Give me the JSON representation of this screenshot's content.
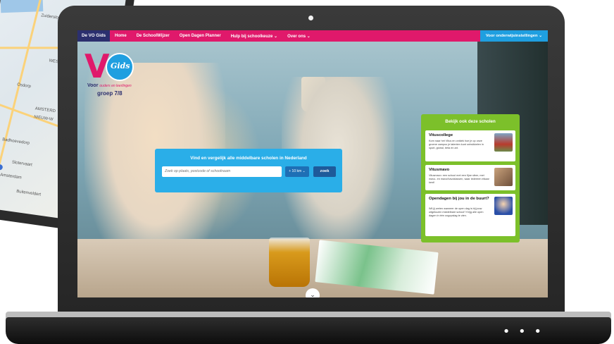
{
  "map": {
    "labels": [
      "Zuidersloot",
      "WESTPO",
      "AMSTERD",
      "NIEUW-W",
      "Badhoevedorp",
      "Osdorp",
      "Slotervaart",
      "Amsterdam",
      "Buitenveldert"
    ]
  },
  "nav": {
    "brand": "De VO Gids",
    "items": [
      "Home",
      "De SchoolWijzer",
      "Open Dagen Planner",
      "Hulp bij schoolkeuze ⌄",
      "Over ons ⌄"
    ],
    "right": "Voor onderwijsinstellingen ⌄"
  },
  "logo": {
    "letter": "V",
    "circle_text": "Gids",
    "line1_a": "Voor",
    "line1_b": "ouders en leerlingen",
    "line2": "groep 7/8"
  },
  "search": {
    "title": "Vind en vergelijk alle middelbare scholen in Nederland",
    "placeholder": "Zoek op plaats, postcode of schoolnaam",
    "radius": "+ 10 km ⌄",
    "button": "zoek"
  },
  "panel": {
    "title": "Bekijk ook deze scholen",
    "cards": [
      {
        "title": "Vituscollege",
        "desc": "Kom naar het Vitus en ontdek hoe je op onze groene campus je talenten kunt ontwikkelen in sport, global, bèta en art."
      },
      {
        "title": "Vitusmavo",
        "desc": "Vitusmavo: een school met een fijne sfeer, met mavo- en mavo/havoklassen, waar iedereen elkaar kent!"
      },
      {
        "title": "Opendagen bij jou in de buurt?",
        "desc": "Wil jij weten wanneer de open dag is bij jouw uitgekozen middelbare school? Krijg alle open dagen in één oogopslag te zien."
      }
    ]
  },
  "scroll_icon": "chevron-down-icon",
  "base_dots": "• • •",
  "colors": {
    "pink": "#e0196b",
    "navy": "#2b2f6e",
    "blue": "#2aaee8",
    "green": "#7cc02a"
  }
}
